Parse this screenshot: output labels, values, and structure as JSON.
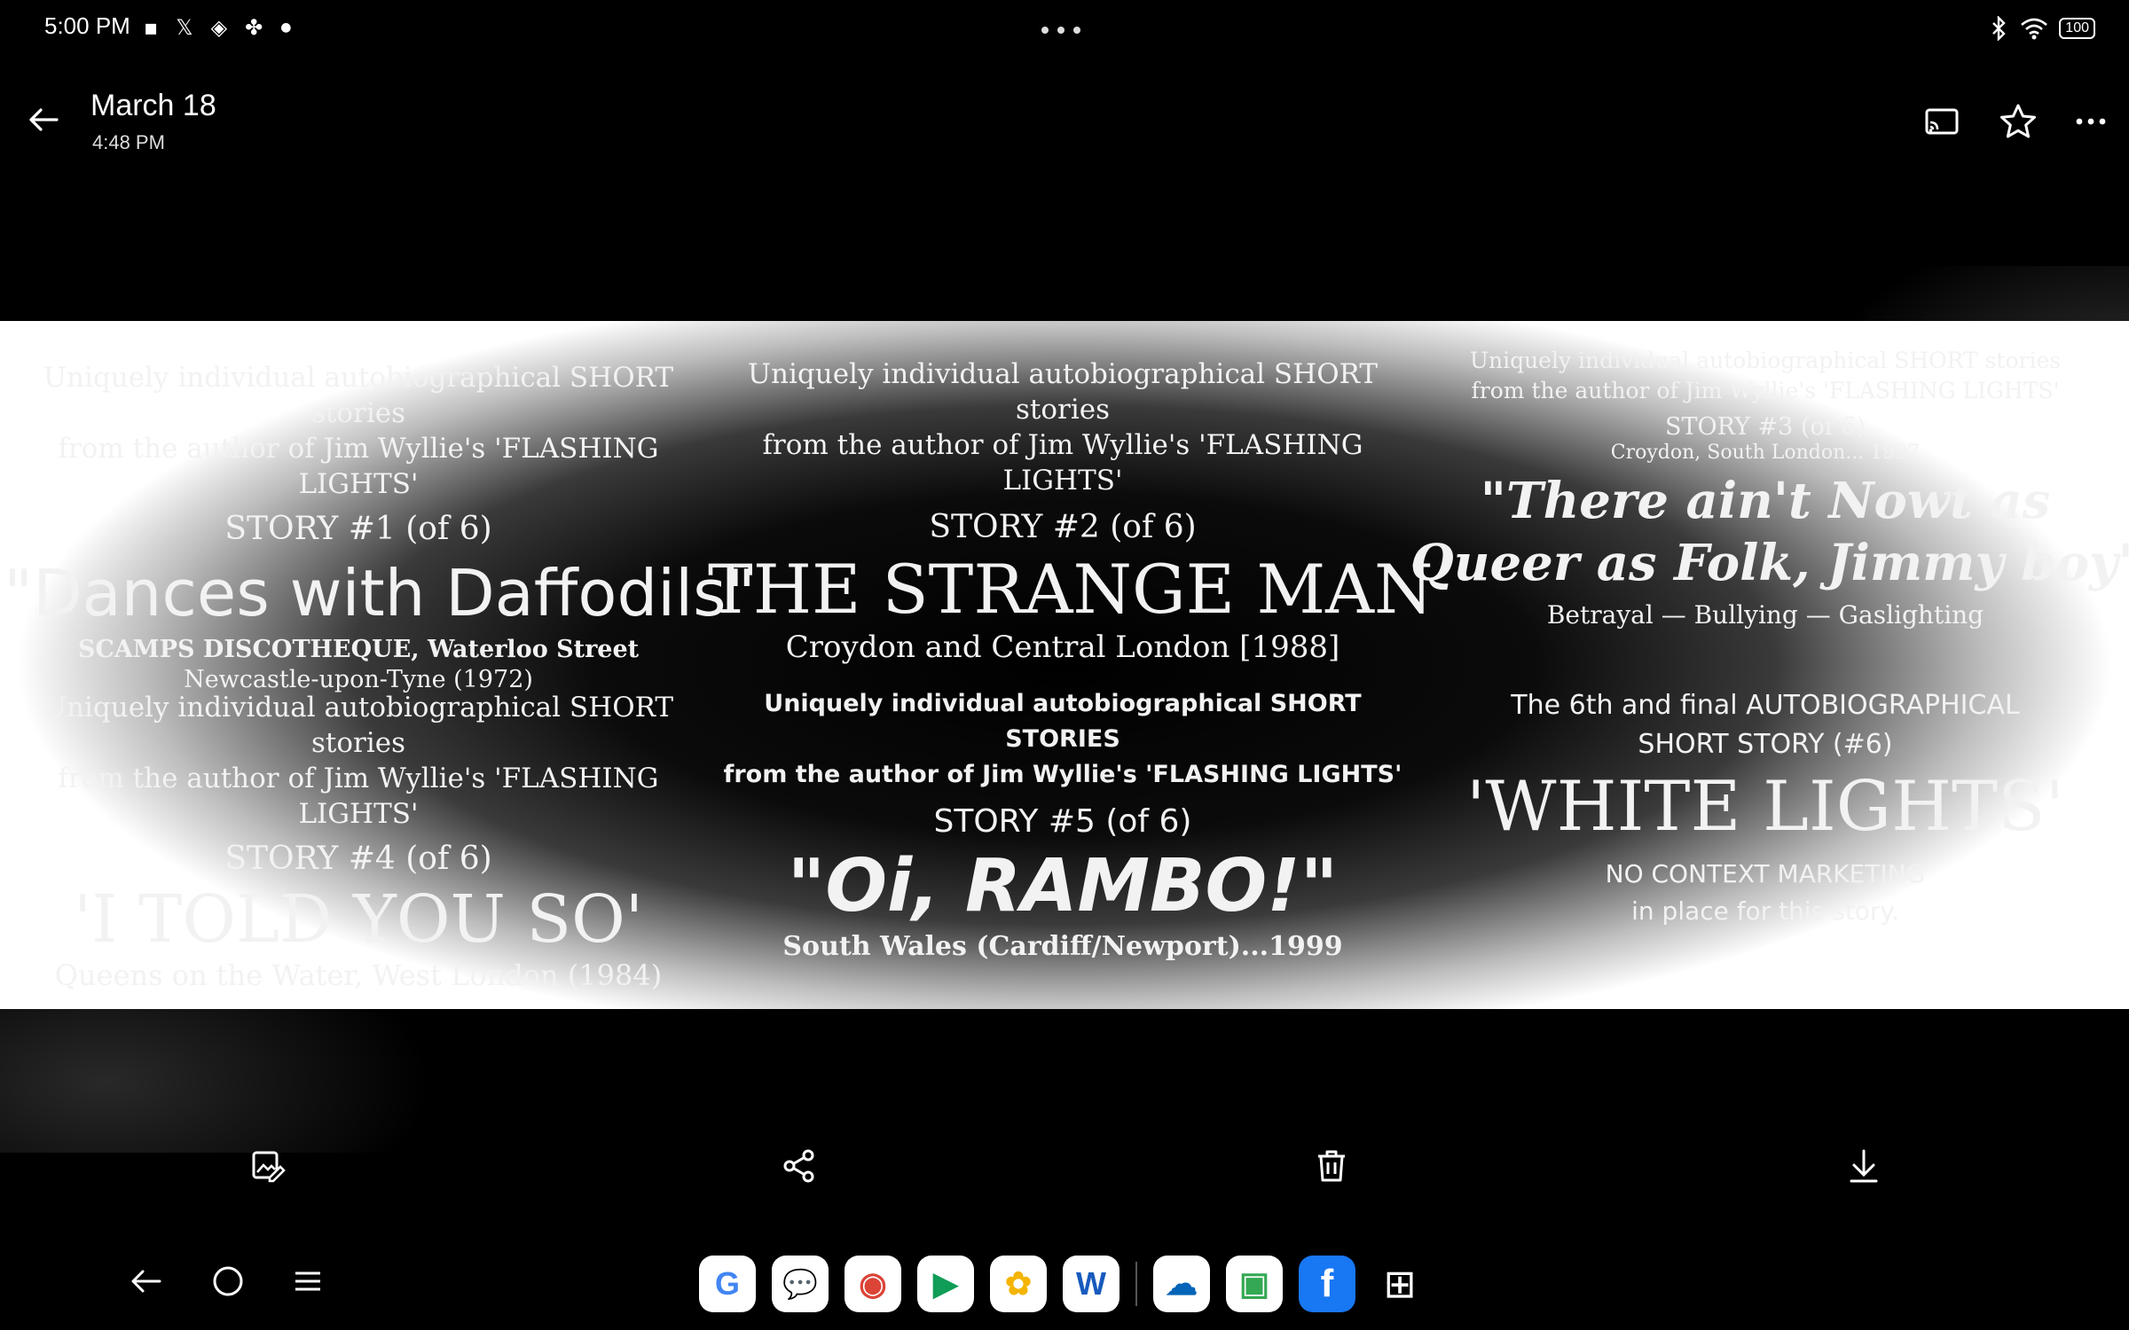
{
  "status_bar": {
    "time": "5:00 PM",
    "left_icons": [
      "sim-card-icon",
      "x-app-icon",
      "stack-app-icon",
      "pinwheel-app-icon",
      "notification-dot"
    ],
    "right_icons": [
      "bluetooth-icon",
      "wifi-icon"
    ],
    "battery": "100"
  },
  "header": {
    "title": "March 18",
    "subtitle": "4:48 PM",
    "actions": [
      "cast-icon",
      "star-icon",
      "more-icon"
    ]
  },
  "image": {
    "panels": [
      {
        "line1": "Uniquely individual autobiographical SHORT stories",
        "line2": "from the author of Jim Wyllie's 'FLASHING LIGHTS'",
        "story_no": "STORY #1 (of 6)",
        "title": "\"Dances with Daffodils\"",
        "sub1": "SCAMPS DISCOTHEQUE, Waterloo Street",
        "sub2": "Newcastle-upon-Tyne (1972)"
      },
      {
        "line1": "Uniquely individual autobiographical SHORT stories",
        "line2": "from the author of Jim Wyllie's 'FLASHING LIGHTS'",
        "story_no": "STORY #2 (of 6)",
        "title": "THE STRANGE MAN",
        "sub1": "Croydon and Central London [1988]"
      },
      {
        "line1": "Uniquely individual autobiographical SHORT stories",
        "line2": "from the author of Jim Wyllie's 'FLASHING LIGHTS'",
        "story_no": "STORY #3 (of 6)",
        "place": "Croydon, South London... 1997",
        "title_l1": "\"There ain't Nowt as",
        "title_l2": "Queer as Folk, Jimmy boy\"",
        "sub1": "Betrayal — Bullying — Gaslighting"
      },
      {
        "line1": "Uniquely individual autobiographical SHORT stories",
        "line2": "from the author of Jim Wyllie's 'FLASHING LIGHTS'",
        "story_no": "STORY #4 (of 6)",
        "title": "'I TOLD YOU SO'",
        "sub1": "Queens on the Water, West London (1984)"
      },
      {
        "line1": "Uniquely individual autobiographical SHORT STORIES",
        "line2": "from the author of Jim Wyllie's 'FLASHING LIGHTS'",
        "story_no": "STORY #5 (of 6)",
        "title": "\"Oi, RAMBO!\"",
        "sub1": "South Wales (Cardiff/Newport)...1999"
      },
      {
        "line1": "The 6th and final AUTOBIOGRAPHICAL",
        "line2": "SHORT STORY (#6)",
        "title": "'WHITE LIGHTS'",
        "sub1": "NO CONTEXT MARKETING",
        "sub2": "in place for this story."
      }
    ]
  },
  "actions": [
    "edit-icon",
    "share-icon",
    "delete-icon",
    "download-icon"
  ],
  "nav": [
    "back-icon",
    "home-icon",
    "recents-icon"
  ],
  "dock": [
    {
      "name": "google",
      "glyph": "G",
      "color": "#4285F4"
    },
    {
      "name": "messages",
      "glyph": "💬",
      "color": "#1a73e8"
    },
    {
      "name": "chrome",
      "glyph": "◉",
      "color": "#DB4437"
    },
    {
      "name": "play-store",
      "glyph": "▶",
      "color": "#0F9D58"
    },
    {
      "name": "photos",
      "glyph": "✿",
      "color": "#F4B400"
    },
    {
      "name": "office",
      "glyph": "W",
      "color": "#185ABD"
    },
    {
      "name": "onedrive",
      "glyph": "☁",
      "color": "#0364B8"
    },
    {
      "name": "gallery",
      "glyph": "▣",
      "color": "#34A853"
    },
    {
      "name": "facebook",
      "glyph": "f",
      "color": "#ffffff"
    },
    {
      "name": "app-drawer",
      "glyph": "⊞",
      "color": "#ffffff"
    }
  ]
}
